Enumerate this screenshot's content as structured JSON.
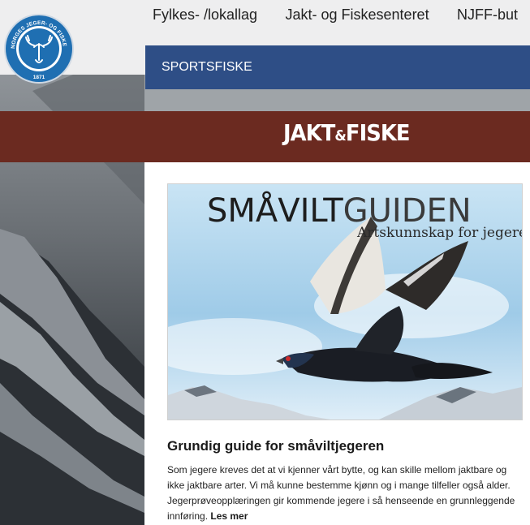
{
  "top_nav": {
    "items": [
      {
        "label": "Fylkes- /lokallag"
      },
      {
        "label": "Jakt- og Fiskesenteret"
      },
      {
        "label": "NJFF-but"
      }
    ]
  },
  "logo": {
    "ring_text": "NORGES JEGER- OG FISKERFORBUND",
    "year": "1871"
  },
  "sub_nav": {
    "active_label": "SPORTSFISKE"
  },
  "brand": {
    "left": "JAKT",
    "amp": "&",
    "right": "FISKE"
  },
  "hero": {
    "title_bold": "SMÅVILT",
    "title_light": "GUIDEN",
    "subtitle": "Artskunnskap for jegere"
  },
  "article": {
    "title": "Grundig guide for småviltjegeren",
    "body": "Som jegere kreves det at vi kjenner vårt bytte, og kan skille mellom jaktbare og ikke jaktbare arter. Vi må kunne bestemme kjønn og i mange tilfeller også alder. Jegerprøveopplæringen gir kommende jegere i så henseende en grunnleggende innføring.",
    "read_more": "Les mer"
  },
  "colors": {
    "nav_blue": "#2e4e86",
    "brand_band": "#6b2a20",
    "logo_blue": "#1f6fb2"
  }
}
